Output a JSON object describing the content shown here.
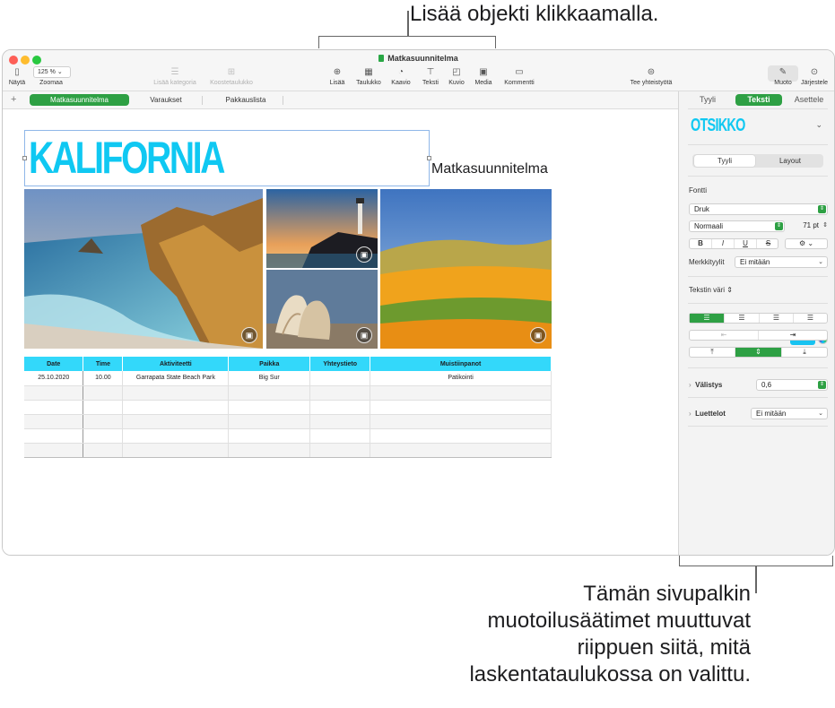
{
  "callouts": {
    "top": "Lisää objekti klikkaamalla.",
    "bottom_lines": [
      "Tämän sivupalkin",
      "muotoilusäätimet muuttuvat",
      "riippuen siitä, mitä",
      "laskentataulukossa on valittu."
    ]
  },
  "window": {
    "title": "Matkasuunnitelma"
  },
  "toolbar": {
    "items": [
      {
        "label": "Näytä",
        "icon": "sidebar-icon"
      },
      {
        "label": "Zoomaa",
        "icon": "zoom-icon",
        "value": "125 %"
      },
      {
        "label": "Lisää kategoria",
        "icon": "category-icon",
        "disabled": true
      },
      {
        "label": "Koostetaulukko",
        "icon": "pivot-table-icon",
        "disabled": true
      },
      {
        "label": "Lisää",
        "icon": "insert-icon"
      },
      {
        "label": "Taulukko",
        "icon": "table-icon"
      },
      {
        "label": "Kaavio",
        "icon": "chart-icon"
      },
      {
        "label": "Teksti",
        "icon": "text-icon"
      },
      {
        "label": "Kuvio",
        "icon": "shape-icon"
      },
      {
        "label": "Media",
        "icon": "media-icon"
      },
      {
        "label": "Kommentti",
        "icon": "comment-icon"
      },
      {
        "label": "Tee yhteistyötä",
        "icon": "collaborate-icon"
      },
      {
        "label": "Muoto",
        "icon": "format-brush-icon"
      },
      {
        "label": "Järjestele",
        "icon": "organize-icon"
      }
    ]
  },
  "sheets": {
    "add_symbol": "+",
    "tabs": [
      "Matkasuunnitelma",
      "Varaukset",
      "Pakkauslista"
    ],
    "active": 0
  },
  "document": {
    "title": "KALIFORNIA",
    "subtitle": "Matkasuunnitelma",
    "photo_badge_icon": "image-icon"
  },
  "table": {
    "headers": [
      "Date",
      "Time",
      "Aktiviteetti",
      "Paikka",
      "Yhteystieto",
      "Muistiinpanot"
    ],
    "rows": [
      [
        "25.10.2020",
        "10.00",
        "Garrapata State Beach Park",
        "Big Sur",
        "",
        "Patikointi"
      ],
      [
        "",
        "",
        "",
        "",
        "",
        ""
      ],
      [
        "",
        "",
        "",
        "",
        "",
        ""
      ],
      [
        "",
        "",
        "",
        "",
        "",
        ""
      ],
      [
        "",
        "",
        "",
        "",
        "",
        ""
      ],
      [
        "",
        "",
        "",
        "",
        "",
        ""
      ]
    ]
  },
  "sidebar": {
    "tabs": [
      "Tyyli",
      "Teksti",
      "Asettele"
    ],
    "active_tab": 1,
    "paragraph_style": "OTSIKKO",
    "subtabs": [
      "Tyyli",
      "Layout"
    ],
    "font_section": "Fontti",
    "font_name": "Druk",
    "font_weight": "Normaali",
    "font_size": "71 pt",
    "style_buttons": [
      "B",
      "I",
      "U",
      "S"
    ],
    "char_styles_label": "Merkkityylit",
    "char_styles_value": "Ei mitään",
    "text_color_label": "Tekstin väri",
    "text_color": "#18c3f1",
    "spacing_label": "Välistys",
    "spacing_value": "0,6",
    "lists_label": "Luettelot",
    "lists_value": "Ei mitään"
  }
}
